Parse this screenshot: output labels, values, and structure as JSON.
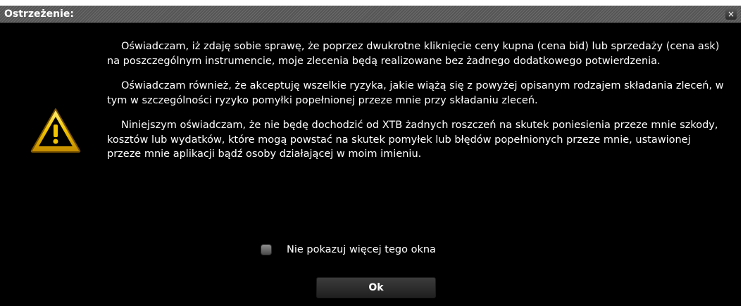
{
  "dialog": {
    "title": "Ostrzeżenie:",
    "close_glyph": "×",
    "icon": "warning-triangle-icon",
    "paragraphs": [
      "Oświadczam, iż zdaję sobie sprawę, że poprzez dwukrotne kliknięcie ceny kupna (cena bid) lub sprzedaży (cena ask) na poszczególnym instrumencie, moje zlecenia będą realizowane bez żadnego dodatkowego potwierdzenia.",
      "Oświadczam również, że akceptuję wszelkie ryzyka, jakie wiążą się z powyżej opisanym rodzajem składania zleceń, w tym w szczególności ryzyko pomyłki popełnionej przeze mnie przy składaniu zleceń.",
      "Niniejszym oświadczam, że nie będę dochodzić od XTB żadnych roszczeń na skutek poniesienia przeze mnie szkody, kosztów lub wydatków, które mogą powstać na skutek pomyłek lub błędów popełnionych przeze mnie, ustawionej przeze mnie aplikacji bądź osoby działającej w moim imieniu."
    ],
    "checkbox_label": "Nie pokazuj więcej tego okna",
    "checkbox_checked": false,
    "ok_label": "Ok"
  },
  "colors": {
    "background": "#000000",
    "text": "#ffffff",
    "warning_yellow": "#f2c300"
  }
}
